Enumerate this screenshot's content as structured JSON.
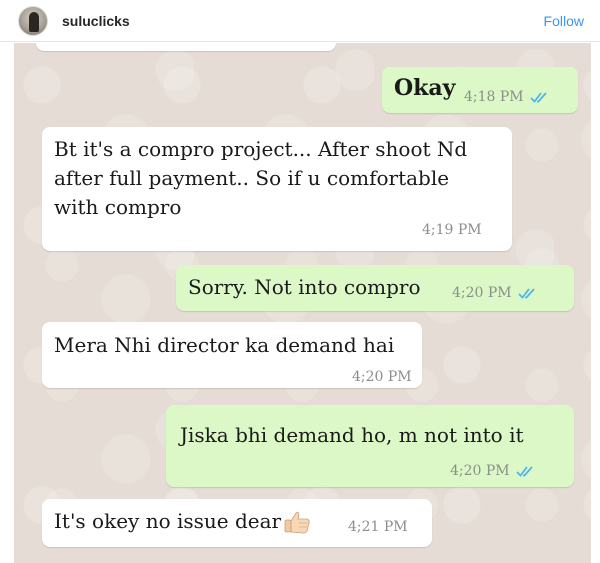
{
  "header": {
    "username": "suluclicks",
    "follow_label": "Follow"
  },
  "colors": {
    "incoming_bubble": "#ffffff",
    "outgoing_bubble": "#dcf8c6",
    "chat_background": "#e5ddd5",
    "read_ticks": "#4fb6ec",
    "follow": "#3897f0"
  },
  "messages": [
    {
      "direction": "out",
      "text": "Okay",
      "time": "4;18 PM",
      "status_icon": "double-check-blue-icon"
    },
    {
      "direction": "in",
      "text": "Bt it's a compro project... After shoot Nd after full payment.. So if u comfortable with compro",
      "time": "4;19 PM"
    },
    {
      "direction": "out",
      "text": "Sorry. Not into compro",
      "time": "4;20 PM",
      "status_icon": "double-check-blue-icon"
    },
    {
      "direction": "in",
      "text": "Mera Nhi director ka demand hai",
      "time": "4;20 PM"
    },
    {
      "direction": "out",
      "text": "Jiska bhi demand ho, m not into it",
      "time": "4;20 PM",
      "status_icon": "double-check-blue-icon"
    },
    {
      "direction": "in",
      "text": "It's okey no issue dear",
      "time": "4;21 PM",
      "emoji_icon": "thumbs-up-icon"
    }
  ]
}
